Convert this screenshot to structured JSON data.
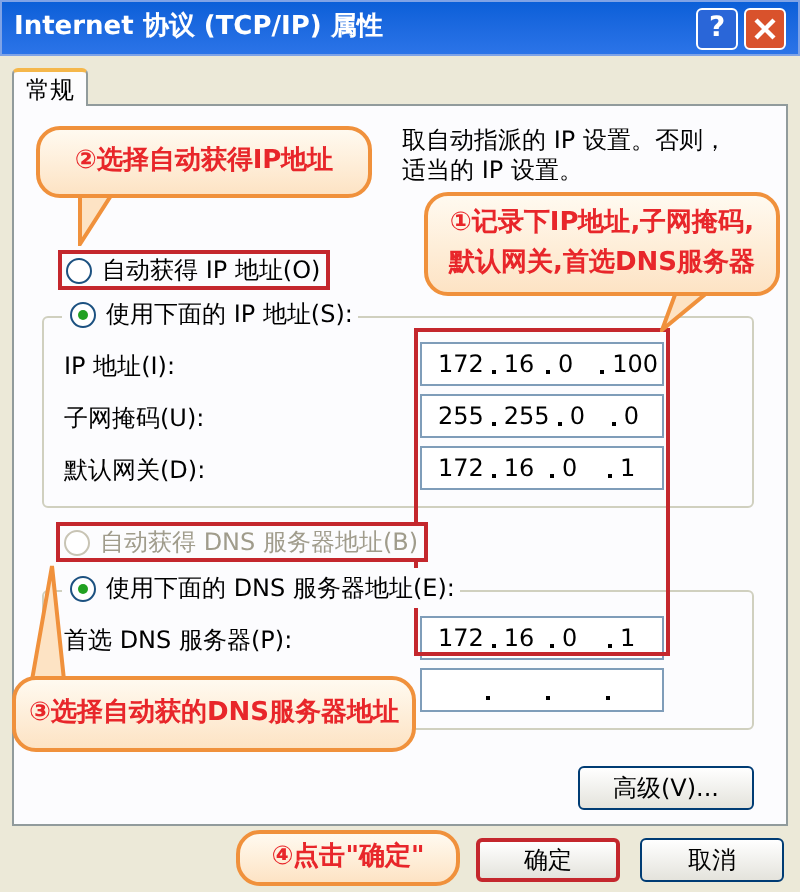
{
  "window": {
    "title": "Internet 协议 (TCP/IP) 属性",
    "help_button": "?"
  },
  "tabs": [
    {
      "label": "常规",
      "selected": true
    }
  ],
  "intro": [
    "取自动指派的 IP 设置。否则，",
    "适当的 IP 设置。"
  ],
  "ip_mode": [
    {
      "label": "自动获得 IP 地址(O)",
      "selected": false,
      "disabled": false
    },
    {
      "label": "使用下面的 IP 地址(S):",
      "selected": true,
      "disabled": false
    }
  ],
  "ip_fields": [
    {
      "label": "IP 地址(I):",
      "octets": [
        "172",
        "16",
        "0",
        "100"
      ]
    },
    {
      "label": "子网掩码(U):",
      "octets": [
        "255",
        "255",
        "0",
        "0"
      ]
    },
    {
      "label": "默认网关(D):",
      "octets": [
        "172",
        "16",
        "0",
        "1"
      ]
    }
  ],
  "dns_mode": [
    {
      "label": "自动获得 DNS 服务器地址(B)",
      "selected": false,
      "disabled": true
    },
    {
      "label": "使用下面的 DNS 服务器地址(E):",
      "selected": true,
      "disabled": false
    }
  ],
  "dns_fields": [
    {
      "kind": "filled",
      "label": "首选 DNS 服务器(P):",
      "octets": [
        "172",
        "16",
        "0",
        "1"
      ]
    },
    {
      "kind": "blank"
    }
  ],
  "advanced_button": "高级(V)...",
  "buttons": [
    "确定",
    "取消"
  ],
  "annotations": [
    "②选择自动获得IP地址",
    "①记录下IP地址,子网掩码,默认网关,首选DNS服务器",
    "③选择自动获的DNS服务器地址",
    "④点击\"确定\""
  ]
}
